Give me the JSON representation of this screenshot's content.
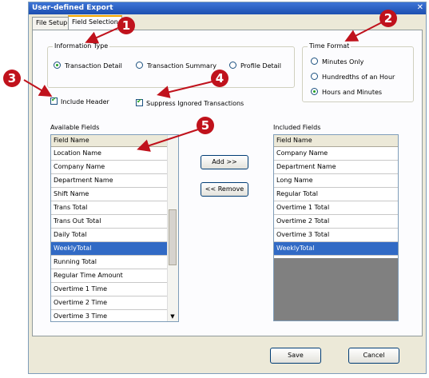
{
  "window": {
    "title": "User-defined Export",
    "close_glyph": "✕"
  },
  "tabs": [
    {
      "label": "File Setup",
      "active": false
    },
    {
      "label": "Field Selection",
      "active": true
    }
  ],
  "information_type": {
    "legend": "Information Type",
    "options": [
      {
        "label": "Transaction Detail",
        "selected": true
      },
      {
        "label": "Transaction Summary",
        "selected": false
      },
      {
        "label": "Profile Detail",
        "selected": false
      }
    ]
  },
  "time_format": {
    "legend": "Time Format",
    "options": [
      {
        "label": "Minutes Only",
        "selected": false
      },
      {
        "label": "Hundredths of an Hour",
        "selected": false
      },
      {
        "label": "Hours and Minutes",
        "selected": true
      }
    ]
  },
  "checkboxes": {
    "include_header": {
      "label": "Include Header",
      "checked": true
    },
    "suppress_ignored": {
      "label": "Suppress Ignored Transactions",
      "checked": true
    }
  },
  "available_fields": {
    "caption": "Available Fields",
    "header": "Field Name",
    "rows": [
      "Location Name",
      "Company Name",
      "Department Name",
      "Shift Name",
      "Trans Total",
      "Trans Out Total",
      "Daily Total",
      "WeeklyTotal",
      "Running Total",
      "Regular Time Amount",
      "Overtime 1 Time",
      "Overtime 2 Time",
      "Overtime 3 Time"
    ],
    "selected": "WeeklyTotal"
  },
  "included_fields": {
    "caption": "Included Fields",
    "header": "Field Name",
    "rows": [
      "Company Name",
      "Department Name",
      "Long Name",
      "Regular Total",
      "Overtime 1 Total",
      "Overtime 2 Total",
      "Overtime 3 Total",
      "WeeklyTotal"
    ],
    "selected": "WeeklyTotal"
  },
  "buttons": {
    "add": "Add >>",
    "remove": "<< Remove",
    "save": "Save",
    "cancel": "Cancel"
  },
  "scroll_down_glyph": "▼",
  "callouts": [
    "1",
    "2",
    "3",
    "4",
    "5"
  ],
  "colors": {
    "callout": "#c0121c",
    "selection": "#316ac5",
    "title_bar": "#2a5fc4"
  }
}
